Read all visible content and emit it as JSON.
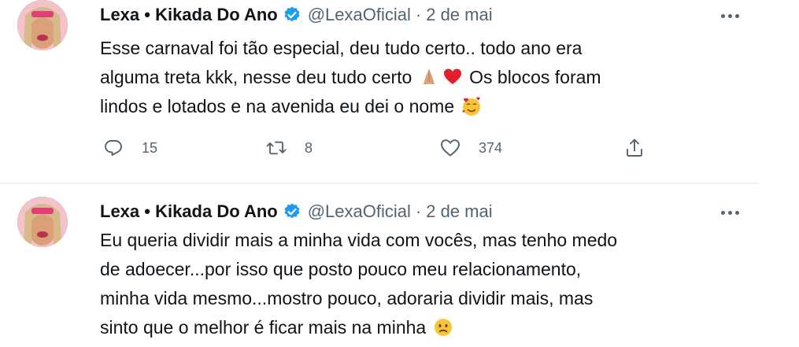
{
  "tweets": [
    {
      "author_name": "Lexa • Kikada Do Ano",
      "handle": "@LexaOficial",
      "separator": "·",
      "date": "2 de mai",
      "lines": [
        "Esse carnaval foi tão especial, deu tudo certo.. todo ano era",
        "alguma treta kkk, nesse deu tudo certo",
        "Os blocos foram",
        "lindos e lotados e na avenida eu dei o nome"
      ],
      "emojis": [
        "folded-hands-emoji",
        "red-heart-emoji",
        "smiling-face-with-hearts-emoji"
      ],
      "actions": {
        "replies": "15",
        "retweets": "8",
        "likes": "374"
      }
    },
    {
      "author_name": "Lexa • Kikada Do Ano",
      "handle": "@LexaOficial",
      "separator": "·",
      "date": "2 de mai",
      "lines": [
        "Eu queria dividir mais a minha vida com vocês, mas tenho medo",
        "de adoecer...por isso que posto pouco meu relacionamento,",
        "minha vida mesmo...mostro pouco, adoraria dividir mais, mas",
        "sinto que o melhor é ficar mais na minha"
      ],
      "emojis": [
        "slightly-frowning-face-emoji"
      ]
    }
  ],
  "colors": {
    "text": "#0f1419",
    "secondary": "#536471",
    "verified": "#1d9bf0",
    "divider": "#eff3f4"
  }
}
